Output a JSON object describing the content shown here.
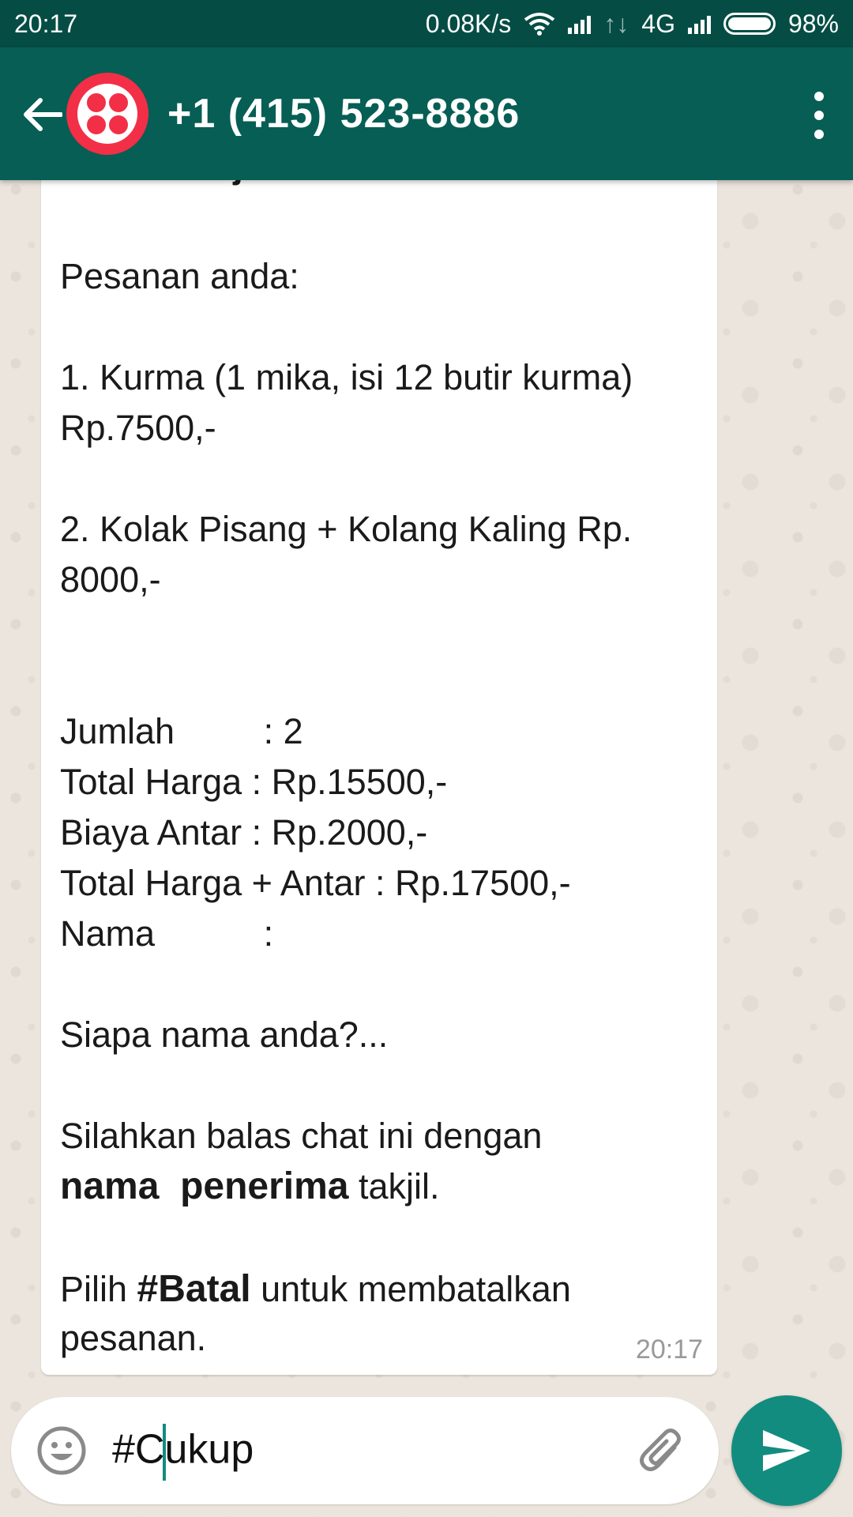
{
  "status_bar": {
    "time": "20:17",
    "net_speed": "0.08K/s",
    "network_type": "4G",
    "battery": "98%"
  },
  "header": {
    "contact": "+1 (415) 523-8886"
  },
  "message": {
    "partial_title": "Pesan Takjil.",
    "lines": [
      "Pesanan anda:",
      "1. Kurma (1 mika, isi 12 butir kurma)",
      "Rp.7500,-",
      "2. Kolak Pisang + Kolang Kaling Rp.",
      "8000,-",
      "Jumlah         : 2",
      "Total Harga : Rp.15500,-",
      "Biaya Antar : Rp.2000,-",
      "Total Harga + Antar : Rp.17500,-",
      "Nama           :",
      "Siapa nama anda?...",
      "Silahkan balas chat ini dengan"
    ],
    "reply_line": {
      "bold": "nama  penerima",
      "rest": " takjil."
    },
    "cancel_line": {
      "prefix": "Pilih ",
      "bold": "#Batal",
      "rest": " untuk membatalkan"
    },
    "last_line": "pesanan.",
    "time": "20:17"
  },
  "composer": {
    "text_before_caret": "#C",
    "text_after_caret": "ukup"
  },
  "colors": {
    "header": "#075e54",
    "status_bar": "#054d44",
    "accent": "#128c7e",
    "twilio_red": "#f22f46"
  },
  "icons": [
    "back-arrow-icon",
    "menu-dots-icon",
    "emoji-icon",
    "attach-icon",
    "send-icon",
    "wifi-icon",
    "signal-icon",
    "battery-icon"
  ]
}
